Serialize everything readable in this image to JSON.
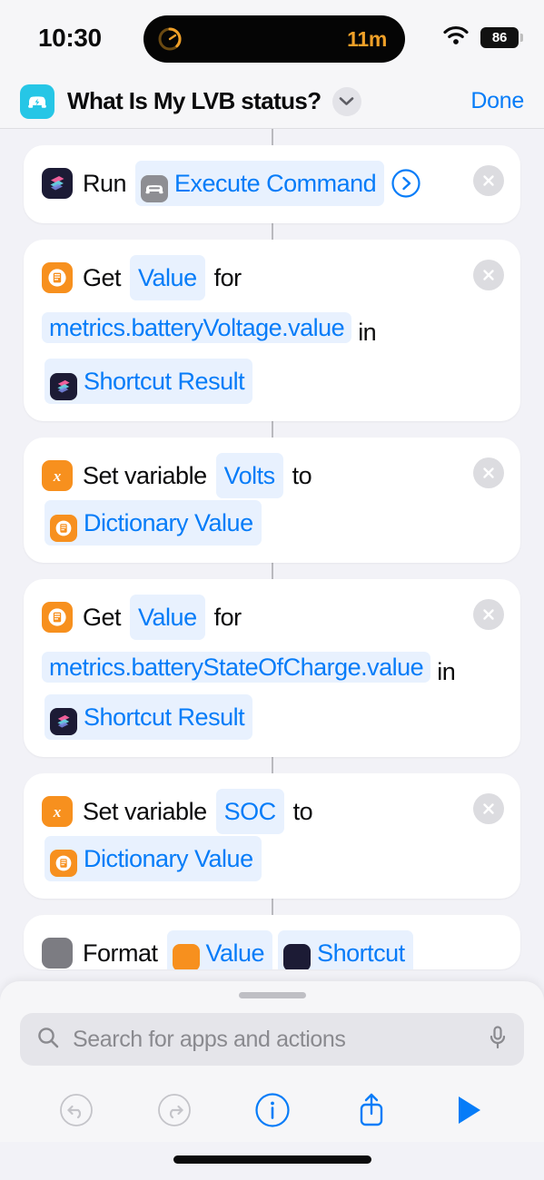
{
  "status_bar": {
    "time": "10:30",
    "island_timer": "11m",
    "battery_level": "86",
    "wifi_icon": "wifi-icon",
    "battery_icon": "battery-icon",
    "timer_ring_icon": "timer-ring-icon"
  },
  "nav": {
    "app_icon": "ev-car-app-icon",
    "title": "What Is My LVB status?",
    "chevron_icon": "chevron-down-icon",
    "done_label": "Done"
  },
  "colors": {
    "accent_blue": "#067cf8",
    "token_blue_bg": "#e8f1fe",
    "orange": "#f7901e",
    "cyan": "#26c6e6",
    "timer_orange": "#f0a028",
    "page_bg": "#f2f2f7",
    "card_bg": "#ffffff"
  },
  "actions": [
    {
      "id": "run-shortcut",
      "lead_icon": "shortcuts-app-icon",
      "segments": [
        {
          "kind": "plain",
          "text": "Run"
        },
        {
          "kind": "icon-token",
          "icon": "car-icon",
          "text": "Execute Command"
        },
        {
          "kind": "disclosure",
          "icon": "chevron-right-circle-icon"
        }
      ],
      "delete_icon": "close-circle-icon"
    },
    {
      "id": "get-value-voltage",
      "lead_icon": "dictionary-icon",
      "segments": [
        {
          "kind": "plain",
          "text": "Get"
        },
        {
          "kind": "token",
          "text": "Value"
        },
        {
          "kind": "plain",
          "text": "for"
        },
        {
          "kind": "token-long",
          "text": "metrics.batteryVoltage.value"
        },
        {
          "kind": "plain",
          "text": "in"
        },
        {
          "kind": "icon-token",
          "icon": "shortcuts-app-icon",
          "text": "Shortcut Result"
        }
      ],
      "delete_icon": "close-circle-icon"
    },
    {
      "id": "set-variable-volts",
      "lead_icon": "variable-x-icon",
      "segments": [
        {
          "kind": "plain",
          "text": "Set variable"
        },
        {
          "kind": "token",
          "text": "Volts"
        },
        {
          "kind": "plain",
          "text": "to"
        },
        {
          "kind": "icon-token",
          "icon": "dictionary-icon",
          "text": "Dictionary Value"
        }
      ],
      "delete_icon": "close-circle-icon"
    },
    {
      "id": "get-value-soc",
      "lead_icon": "dictionary-icon",
      "segments": [
        {
          "kind": "plain",
          "text": "Get"
        },
        {
          "kind": "token",
          "text": "Value"
        },
        {
          "kind": "plain",
          "text": "for"
        },
        {
          "kind": "token-long",
          "text": "metrics.batteryStateOfCharge.value"
        },
        {
          "kind": "plain",
          "text": "in"
        },
        {
          "kind": "icon-token",
          "icon": "shortcuts-app-icon",
          "text": "Shortcut Result"
        }
      ],
      "delete_icon": "close-circle-icon"
    },
    {
      "id": "set-variable-soc",
      "lead_icon": "variable-x-icon",
      "segments": [
        {
          "kind": "plain",
          "text": "Set variable"
        },
        {
          "kind": "token",
          "text": "SOC"
        },
        {
          "kind": "plain",
          "text": "to"
        },
        {
          "kind": "icon-token",
          "icon": "dictionary-icon",
          "text": "Dictionary Value"
        }
      ],
      "delete_icon": "close-circle-icon"
    }
  ],
  "search": {
    "placeholder": "Search for apps and actions",
    "value": "",
    "search_icon": "search-icon",
    "mic_icon": "microphone-icon",
    "grabber": "sheet-grabber"
  },
  "toolbar": {
    "items": [
      {
        "name": "undo-button",
        "icon": "undo-icon",
        "enabled": false
      },
      {
        "name": "redo-button",
        "icon": "redo-icon",
        "enabled": false
      },
      {
        "name": "info-button",
        "icon": "info-circle-icon",
        "enabled": true
      },
      {
        "name": "share-button",
        "icon": "share-icon",
        "enabled": true
      },
      {
        "name": "play-button",
        "icon": "play-icon",
        "enabled": true
      }
    ]
  }
}
